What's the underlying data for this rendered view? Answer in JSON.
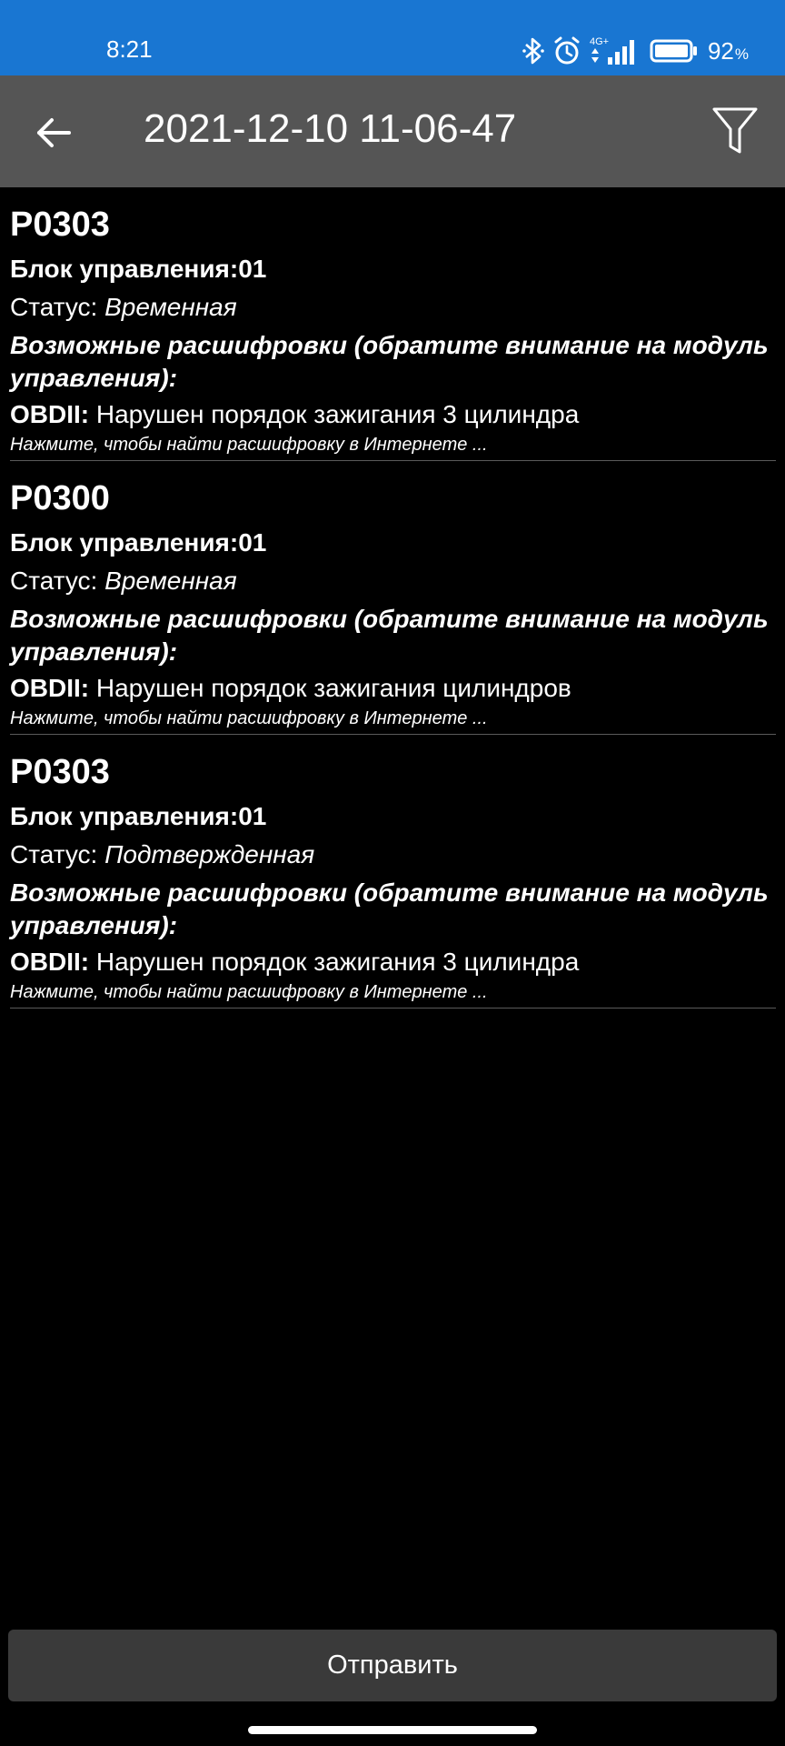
{
  "status_bar": {
    "time": "8:21",
    "network_label": "4G+",
    "battery_value": "92",
    "battery_unit": "%",
    "icons": [
      "bluetooth-icon",
      "alarm-icon",
      "signal-icon",
      "battery-icon"
    ]
  },
  "app_bar": {
    "title": "2021-12-10 11-06-47",
    "back_icon": "arrow-left-icon",
    "filter_icon": "filter-icon"
  },
  "dtc_items": [
    {
      "code": "P0303",
      "ecu": "Блок управления:01",
      "status_label": "Статус: ",
      "status_value": "Временная",
      "possible": "Возможные расшифровки (обратите внимание на модуль управления):",
      "desc_prefix": "OBDII:",
      "desc_text": " Нарушен порядок зажигания 3 цилиндра",
      "hint": "Нажмите, чтобы найти расшифровку в Интернете ..."
    },
    {
      "code": "P0300",
      "ecu": "Блок управления:01",
      "status_label": "Статус: ",
      "status_value": "Временная",
      "possible": "Возможные расшифровки (обратите внимание на модуль управления):",
      "desc_prefix": "OBDII:",
      "desc_text": " Нарушен порядок зажигания цилиндров",
      "hint": "Нажмите, чтобы найти расшифровку в Интернете ..."
    },
    {
      "code": "P0303",
      "ecu": "Блок управления:01",
      "status_label": "Статус: ",
      "status_value": "Подтвержденная",
      "possible": "Возможные расшифровки (обратите внимание на модуль управления):",
      "desc_prefix": "OBDII:",
      "desc_text": " Нарушен порядок зажигания 3 цилиндра",
      "hint": "Нажмите, чтобы найти расшифровку в Интернете ..."
    }
  ],
  "send_button": {
    "label": "Отправить"
  },
  "colors": {
    "status_bar_bg": "#1976d2",
    "app_bar_bg": "#555555",
    "background": "#000000",
    "button_bg": "#3a3a3a",
    "divider": "#5a5a5a",
    "text": "#ffffff"
  }
}
